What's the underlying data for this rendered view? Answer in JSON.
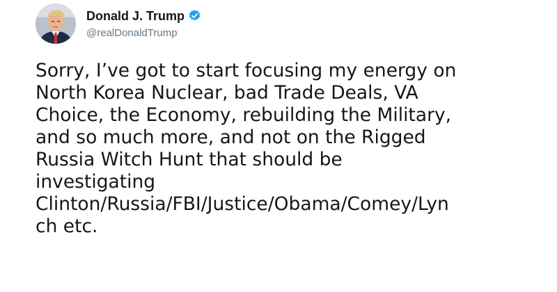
{
  "tweet": {
    "author": {
      "display_name": "Donald J. Trump",
      "handle": "@realDonaldTrump",
      "avatar_icon": "profile-photo",
      "verified_icon": "verified-badge-icon"
    },
    "text_lines": [
      "Sorry, I’ve got to start focusing my energy on",
      "North Korea Nuclear, bad Trade Deals, VA",
      "Choice, the Economy, rebuilding the Military,",
      "and so much more, and not on the Rigged",
      "Russia Witch Hunt that should be",
      "investigating",
      "Clinton/Russia/FBI/Justice/Obama/Comey/Lyn",
      "ch etc."
    ]
  },
  "colors": {
    "text": "#14171a",
    "secondary": "#657786",
    "verified": "#1da1f2"
  }
}
